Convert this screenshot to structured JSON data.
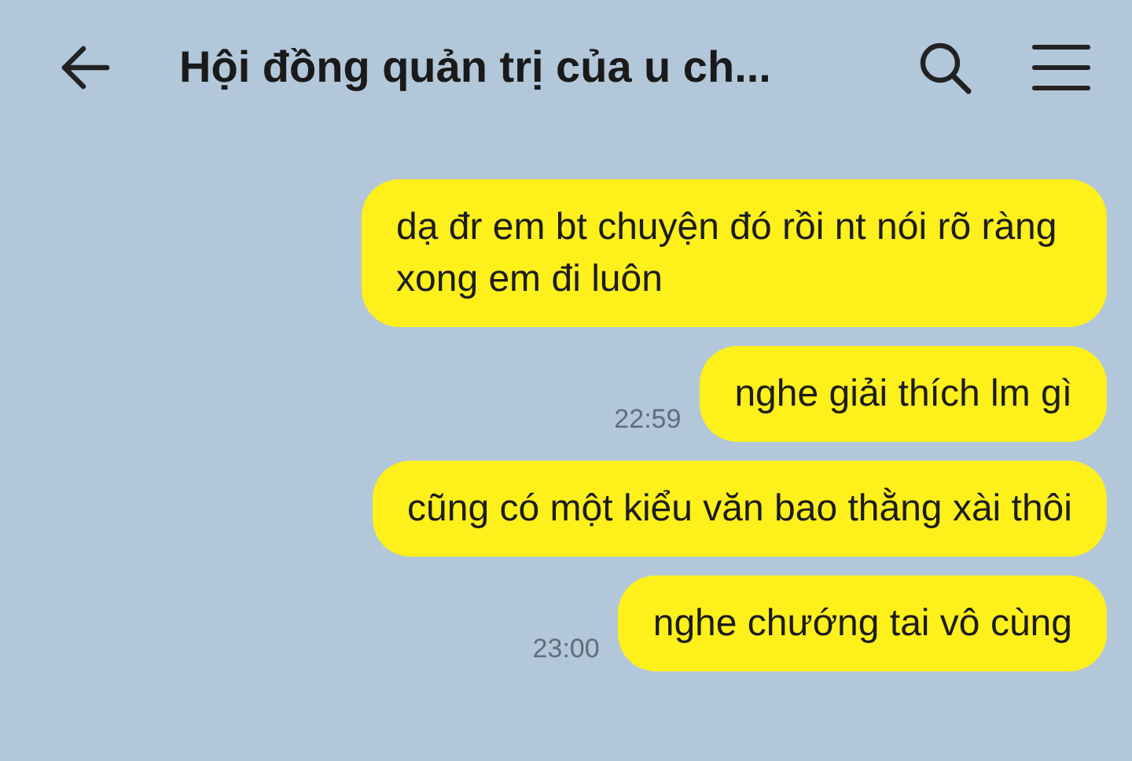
{
  "header": {
    "title": "Hội đồng quản trị của u ch..."
  },
  "messages": [
    {
      "text": "dạ đr em bt chuyện đó rồi nt nói rõ ràng xong em đi luôn"
    },
    {
      "text": "nghe giải thích lm gì",
      "time": "22:59"
    },
    {
      "text": "cũng có một kiểu văn bao thằng xài thôi"
    },
    {
      "text": "nghe chướng tai vô cùng",
      "time": "23:00"
    }
  ]
}
